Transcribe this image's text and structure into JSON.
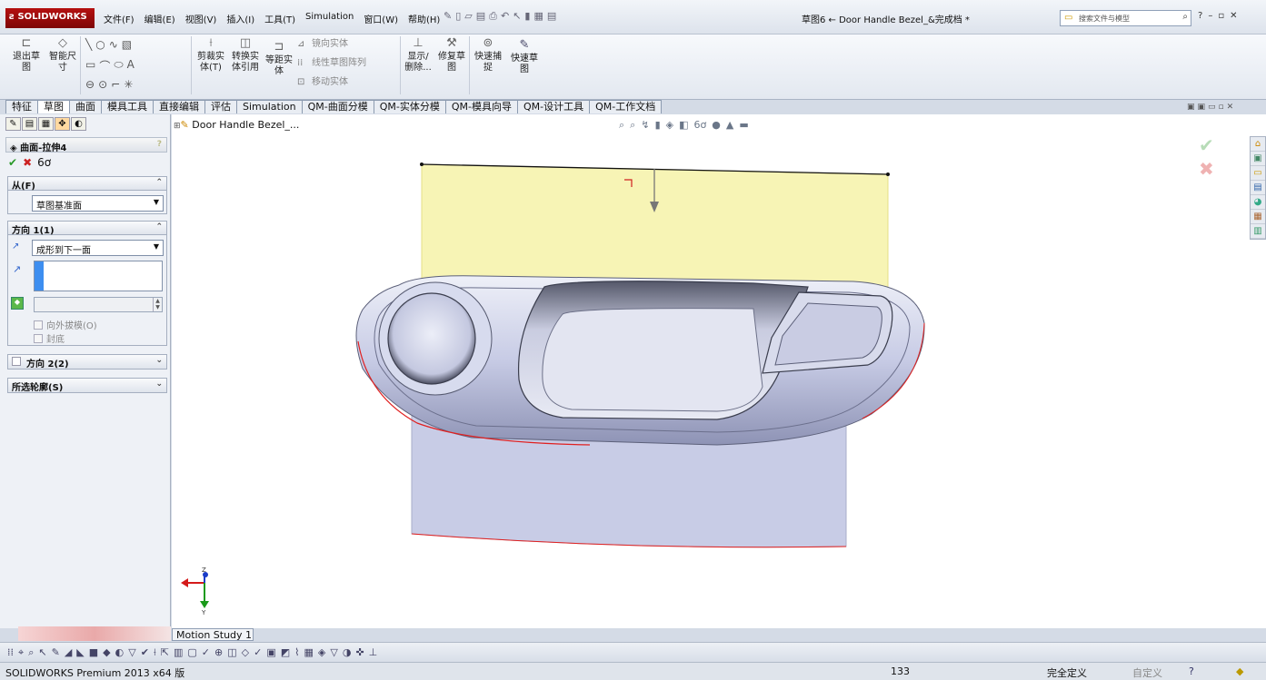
{
  "app": {
    "logo": "SOLIDWORKS",
    "document_title": "草图6 ← Door Handle Bezel_&完成档 *",
    "search_placeholder": "搜索文件与模型"
  },
  "menu": [
    "文件(F)",
    "编辑(E)",
    "视图(V)",
    "插入(I)",
    "工具(T)",
    "Simulation",
    "窗口(W)",
    "帮助(H)"
  ],
  "ribbon": {
    "exit_sketch": "退出草图",
    "smart_dim": "智能尺寸",
    "trim": "剪裁实体(T)",
    "convert": "转换实体引用",
    "offset": "等距实体",
    "mirror": "镜向实体",
    "linear_pattern": "线性草图阵列",
    "move": "移动实体",
    "show_delete": "显示/删除...",
    "repair": "修复草图",
    "quick_snap": "快速捕捉",
    "rapid_sketch": "快速草图"
  },
  "tabs": [
    "特征",
    "草图",
    "曲面",
    "模具工具",
    "直接编辑",
    "评估",
    "Simulation",
    "QM-曲面分模",
    "QM-实体分模",
    "QM-模具向导",
    "QM-设计工具",
    "QM-工作文档"
  ],
  "active_tab": "草图",
  "property_manager": {
    "title": "曲面-拉伸4",
    "from_label": "从(F)",
    "from_value": "草图基准面",
    "dir1_label": "方向 1(1)",
    "dir1_value": "成形到下一面",
    "draft_label": "向外拔模(O)",
    "cap_label": "封底",
    "dir2_label": "方向 2(2)",
    "contours_label": "所选轮廓(S)"
  },
  "tree": {
    "root": "Door Handle Bezel_..."
  },
  "triad": {
    "x": "X",
    "y": "Y",
    "z": "Z"
  },
  "motion_tab": "Motion Study 1",
  "status": {
    "product": "SOLIDWORKS Premium 2013 x64 版",
    "coord": "133",
    "state": "完全定义",
    "custom": "自定义"
  },
  "colors": {
    "surface_yellow": "#f6f2a8",
    "body": "#c9cde8",
    "edge_red": "#e02020",
    "sw_red": "#a80d0d"
  }
}
